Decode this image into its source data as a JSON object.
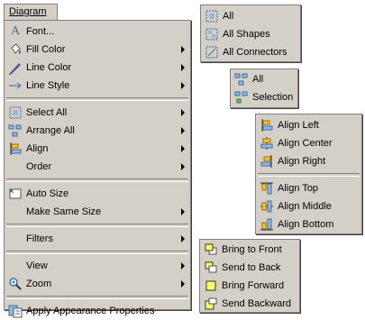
{
  "menubar": {
    "diagram_label": "Diagram"
  },
  "main_menu": {
    "font": "A Font...",
    "font_glyph": "A",
    "font_text": "Font...",
    "fill_color": "Fill Color",
    "line_color": "Line Color",
    "line_style": "Line Style",
    "select_all": "Select All",
    "arrange_all": "Arrange All",
    "align": "Align",
    "order": "Order",
    "auto_size": "Auto Size",
    "make_same_size": "Make Same Size",
    "filters": "Filters",
    "view": "View",
    "zoom": "Zoom",
    "apply_appearance": "Apply Appearance Properties"
  },
  "select_all_menu": {
    "all": "All",
    "all_shapes": "All Shapes",
    "all_connectors": "All Connectors"
  },
  "arrange_menu": {
    "all": "All",
    "selection": "Selection"
  },
  "align_menu": {
    "left": "Align Left",
    "center": "Align Center",
    "right": "Align Right",
    "top": "Align Top",
    "middle": "Align Middle",
    "bottom": "Align Bottom"
  },
  "order_menu": {
    "bring_to_front": "Bring to Front",
    "send_to_back": "Send to Back",
    "bring_forward": "Bring Forward",
    "send_backward": "Send Backward"
  },
  "icons": {
    "fill": "paint-bucket-icon",
    "line_color": "pen-icon",
    "line_style": "arrow-line-icon",
    "select_all": "select-all-icon",
    "arrange": "arrange-icon",
    "align": "align-icon",
    "auto_size": "auto-size-icon",
    "zoom": "zoom-icon",
    "apply": "apply-appearance-icon"
  },
  "colors": {
    "menu_bg": "#d4d0c8",
    "border": "#808080",
    "icon_blue": "#3a6ea5",
    "icon_yellow": "#ffff66"
  }
}
